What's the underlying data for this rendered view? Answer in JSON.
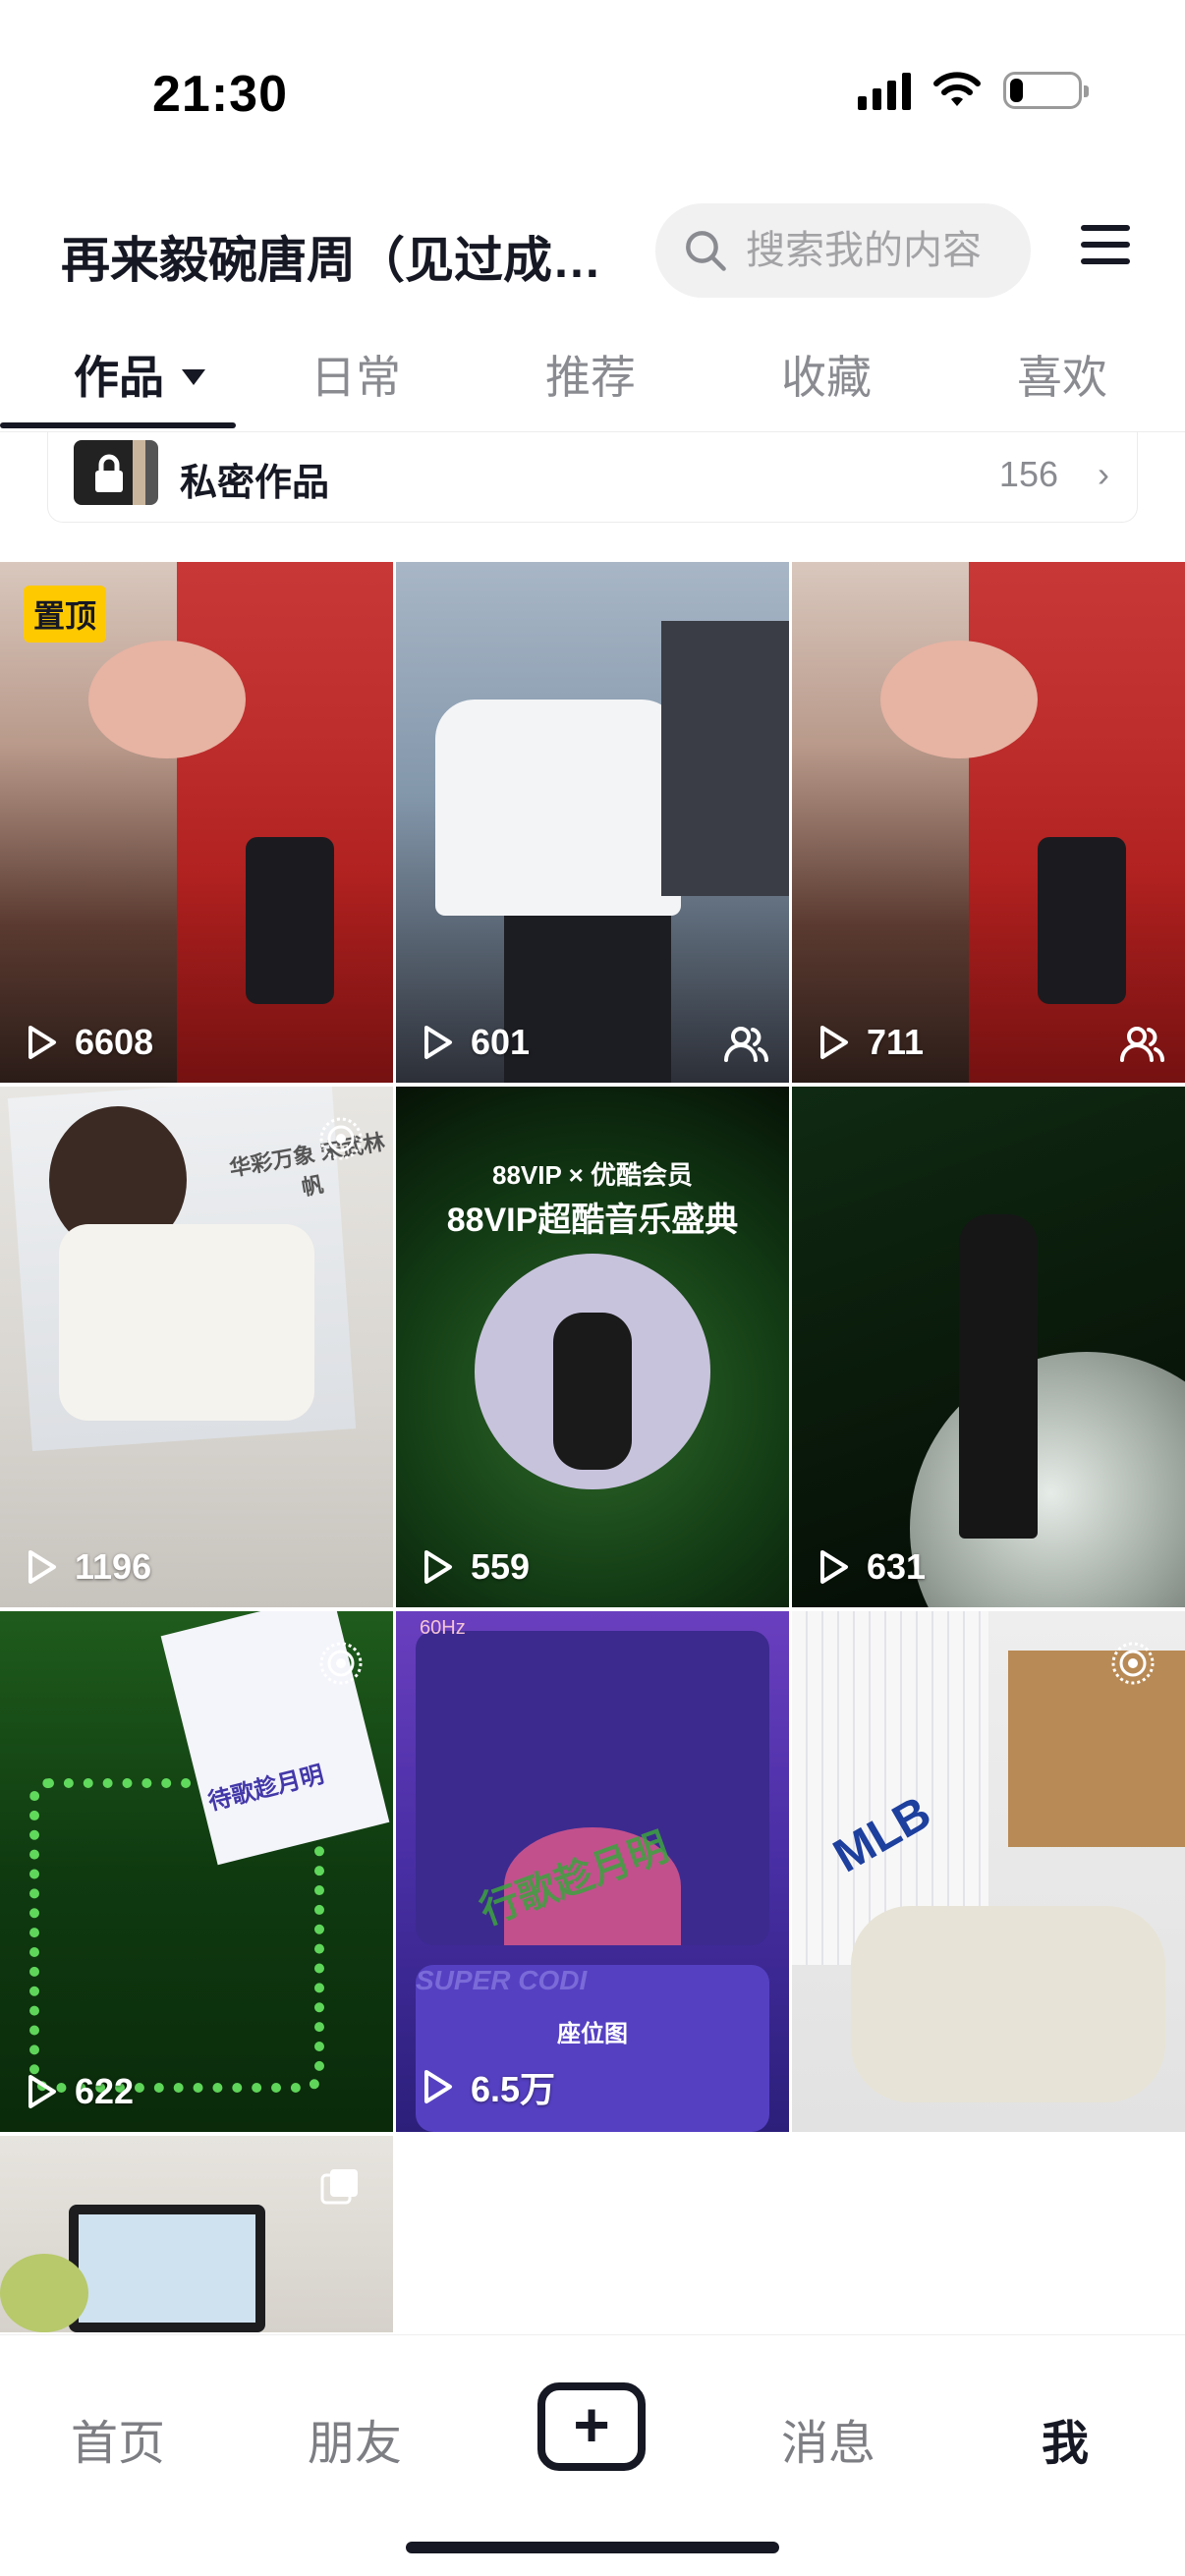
{
  "status_bar": {
    "time": "21:30",
    "icons": [
      "signal-icon",
      "wifi-icon",
      "battery-icon"
    ],
    "battery_level": 0.2
  },
  "header": {
    "title": "再来毅碗唐周（见过成…",
    "search": {
      "placeholder": "搜索我的内容",
      "icon": "search-icon"
    },
    "menu_icon": "hamburger-menu-icon"
  },
  "tabs": [
    {
      "label": "作品",
      "active": true
    },
    {
      "label": "日常",
      "active": false
    },
    {
      "label": "推荐",
      "active": false
    },
    {
      "label": "收藏",
      "active": false
    },
    {
      "label": "喜欢",
      "active": false
    }
  ],
  "private_works": {
    "label": "私密作品",
    "count": "156",
    "chevron": "›"
  },
  "grid": [
    {
      "views": "6608",
      "pinned": true,
      "pin_label": "置顶"
    },
    {
      "views": "601",
      "badge": "friends-icon"
    },
    {
      "views": "711",
      "badge": "friends-icon"
    },
    {
      "views": "1196",
      "badge": "live-photo-icon",
      "overlay": "华彩万象 宋武林帆"
    },
    {
      "views": "559",
      "overlay_1": "88VIP × 优酷会员",
      "overlay_2": "88VIP超酷音乐盛典"
    },
    {
      "views": "631"
    },
    {
      "views": "622",
      "badge": "live-photo-icon",
      "overlay": "待歌趁月明"
    },
    {
      "views": "6.5万",
      "overlay_1": "60Hz",
      "overlay_2": "座位图",
      "overlay_3": "行歌趁月明",
      "overlay_4": "SUPER CODI"
    },
    {
      "views": "",
      "badge": "live-photo-icon",
      "overlay": "MLB"
    },
    {
      "views": "",
      "badge": "multi-image-icon"
    }
  ],
  "bottom_nav": [
    {
      "label": "首页",
      "active": false
    },
    {
      "label": "朋友",
      "active": false
    },
    {
      "label": "+",
      "icon": "add-icon"
    },
    {
      "label": "消息",
      "active": false
    },
    {
      "label": "我",
      "active": true
    }
  ]
}
